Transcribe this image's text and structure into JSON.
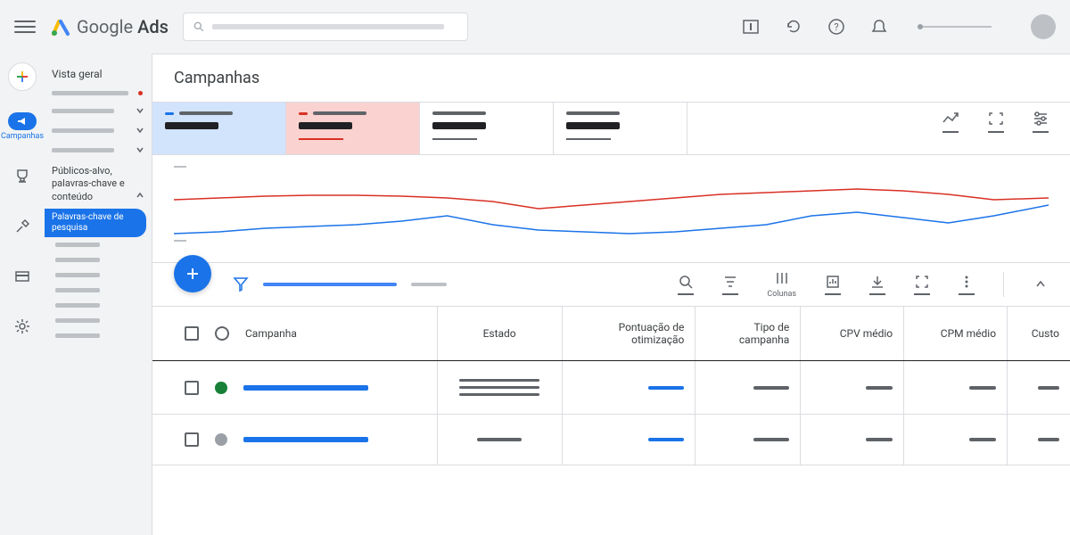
{
  "header": {
    "logo_prefix": "Google",
    "logo_suffix": "Ads"
  },
  "rail": {
    "campaigns_label": "Campanhas"
  },
  "sidebar": {
    "overview": "Vista geral",
    "group_label": "Públicos-alvo, palavras-chave e conteúdo",
    "active_sub": "Palavras-chave de pesquisa"
  },
  "main": {
    "title": "Campanhas"
  },
  "chart_data": {
    "type": "line",
    "x": [
      0,
      1,
      2,
      3,
      4,
      5,
      6,
      7,
      8,
      9,
      10,
      11,
      12,
      13,
      14,
      15,
      16,
      17,
      18,
      19
    ],
    "series": [
      {
        "name": "metric_a",
        "color": "#d93025",
        "values": [
          40,
          38,
          36,
          35,
          35,
          36,
          38,
          42,
          50,
          46,
          42,
          38,
          34,
          32,
          30,
          28,
          30,
          34,
          40,
          38
        ]
      },
      {
        "name": "metric_b",
        "color": "#1a73e8",
        "values": [
          78,
          76,
          72,
          70,
          68,
          64,
          58,
          68,
          74,
          76,
          78,
          76,
          72,
          68,
          58,
          54,
          60,
          66,
          58,
          46
        ]
      }
    ],
    "ylim": [
      0,
      100
    ]
  },
  "toolbar": {
    "columns_label": "Colunas"
  },
  "table": {
    "columns": {
      "campaign": "Campanha",
      "state": "Estado",
      "opt_score": "Pontuação de otimização",
      "type": "Tipo de campanha",
      "cpv": "CPV médio",
      "cpm": "CPM médio",
      "cost": "Custo"
    }
  }
}
